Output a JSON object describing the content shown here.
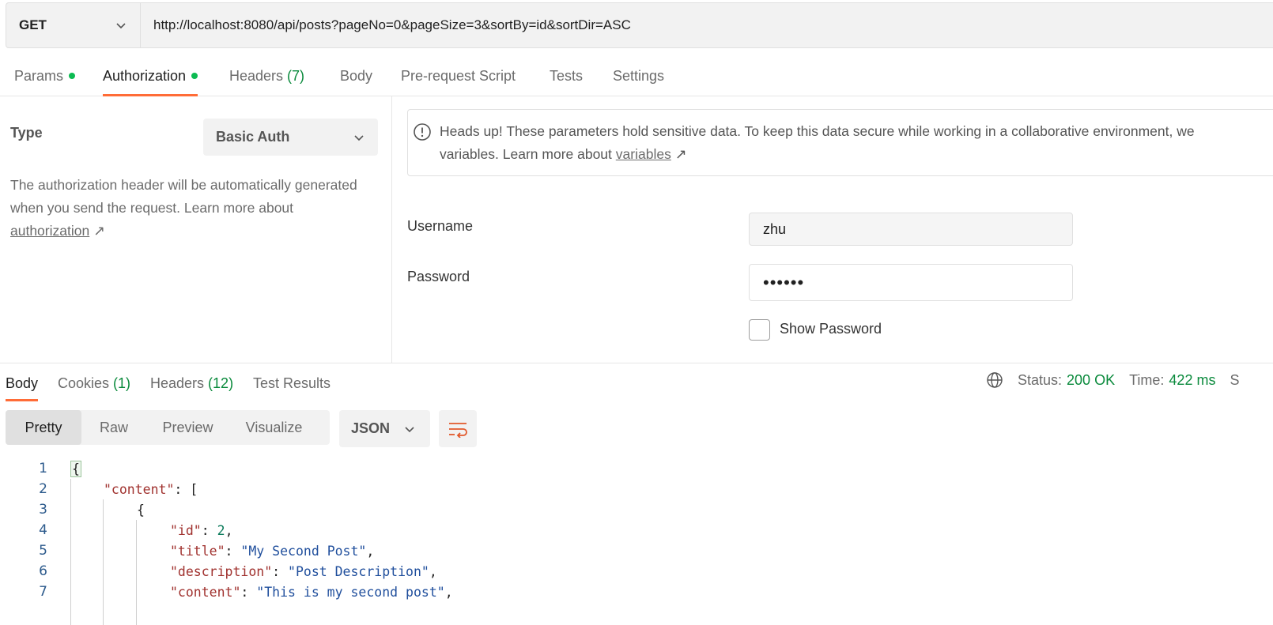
{
  "request": {
    "method": "GET",
    "url": "http://localhost:8080/api/posts?pageNo=0&pageSize=3&sortBy=id&sortDir=ASC"
  },
  "request_tabs": [
    {
      "label": "Params",
      "dot": true
    },
    {
      "label": "Authorization",
      "dot": true,
      "active": true
    },
    {
      "label": "Headers",
      "count": "(7)"
    },
    {
      "label": "Body"
    },
    {
      "label": "Pre-request Script"
    },
    {
      "label": "Tests"
    },
    {
      "label": "Settings"
    }
  ],
  "auth": {
    "type_label": "Type",
    "type_value": "Basic Auth",
    "desc": "The authorization header will be automatically generated when you send the request. Learn more about",
    "desc_link": "authorization",
    "info_line1": "Heads up! These parameters hold sensitive data. To keep this data secure while working in a collaborative environment, we",
    "info_line2": "variables. Learn more about",
    "info_link": "variables",
    "arrow": "↗",
    "username_label": "Username",
    "username_value": "zhu",
    "password_label": "Password",
    "password_value": "••••••",
    "show_password_label": "Show Password"
  },
  "response_tabs": [
    {
      "label": "Body",
      "active": true
    },
    {
      "label": "Cookies",
      "count": "(1)"
    },
    {
      "label": "Headers",
      "count": "(12)"
    },
    {
      "label": "Test Results"
    }
  ],
  "status": {
    "status_label": "Status:",
    "status_value": "200 OK",
    "time_label": "Time:",
    "time_value": "422 ms",
    "trailing": "S"
  },
  "view_modes": [
    "Pretty",
    "Raw",
    "Preview",
    "Visualize"
  ],
  "format": "JSON",
  "code_lines": [
    {
      "num": "1",
      "text": "{"
    },
    {
      "num": "2",
      "key": "\"content\"",
      "rest": ": ["
    },
    {
      "num": "3",
      "text": "{"
    },
    {
      "num": "4",
      "key": "\"id\"",
      "num_value": "2",
      "tail": ","
    },
    {
      "num": "5",
      "key": "\"title\"",
      "str_value": "\"My Second Post\"",
      "tail": ","
    },
    {
      "num": "6",
      "key": "\"description\"",
      "str_value": "\"Post Description\"",
      "tail": ","
    },
    {
      "num": "7",
      "key": "\"content\"",
      "str_value": "\"This is my second post\"",
      "tail": ","
    }
  ]
}
